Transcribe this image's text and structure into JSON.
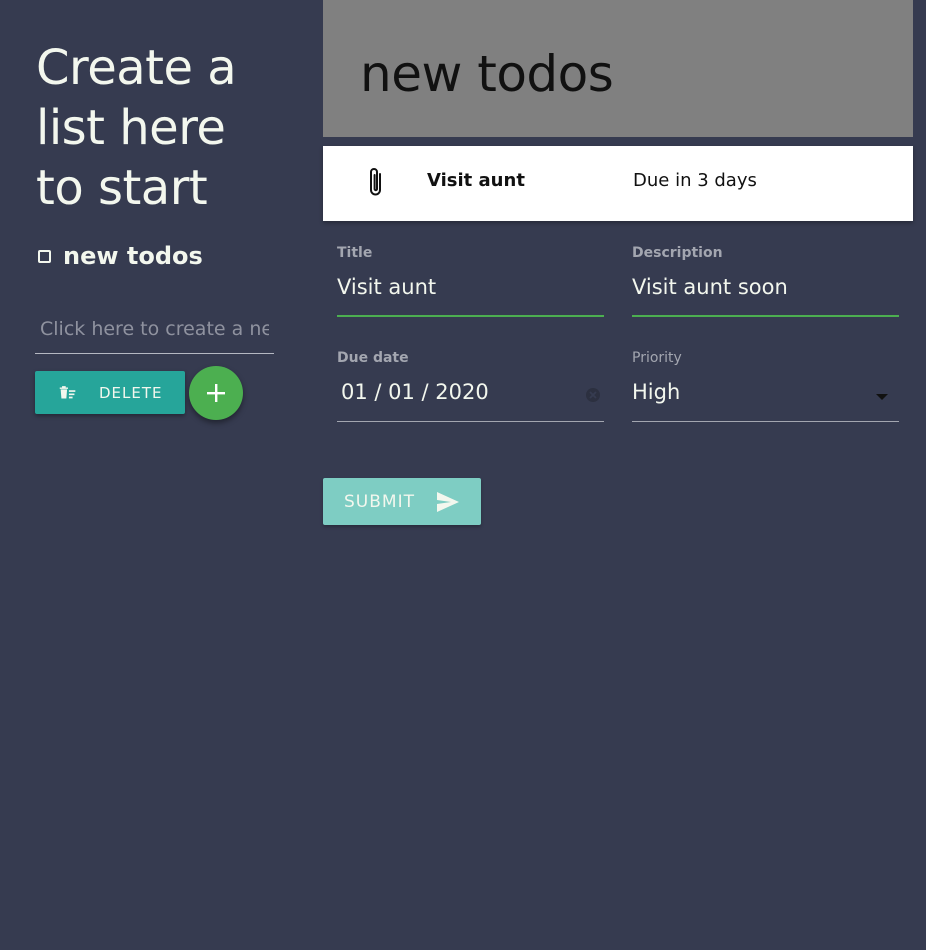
{
  "sidebar": {
    "heading": "Create a list here to start",
    "lists": [
      {
        "name": "new todos",
        "checked": false
      }
    ],
    "new_list_placeholder": "Click here to create a new list",
    "delete_label": "DELETE",
    "delete_icon": "delete-sweep-icon",
    "add_icon": "plus-icon"
  },
  "main": {
    "list_title": "new todos",
    "todos": [
      {
        "icon": "paperclip-icon",
        "title": "Visit aunt",
        "due": "Due in 3 days"
      }
    ],
    "form": {
      "title_label": "Title",
      "title_value": "Visit aunt",
      "description_label": "Description",
      "description_value": "Visit aunt soon",
      "due_date_label": "Due date",
      "due_date_value": "01 / 01 / 2020",
      "priority_label": "Priority",
      "priority_value": "High",
      "submit_label": "SUBMIT",
      "submit_icon": "send-icon"
    }
  },
  "colors": {
    "background": "#363b50",
    "teal": "#26a59a",
    "green": "#4caf50",
    "submit_disabled": "#7ecdc3",
    "header_gray": "#808080"
  }
}
